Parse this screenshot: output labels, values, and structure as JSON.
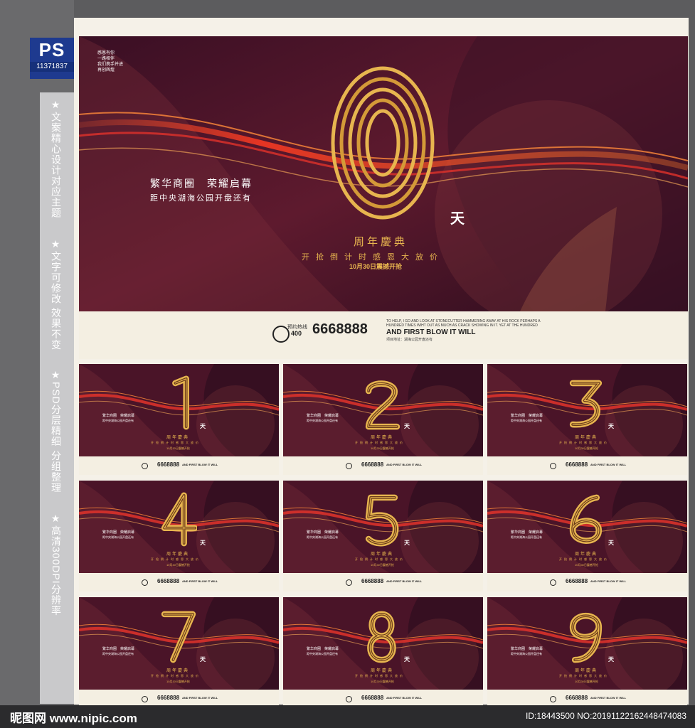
{
  "badge": {
    "label": "PS",
    "number": "11371837"
  },
  "features": [
    "★文案精心设计对应主题",
    "★文字可修改 效果不变",
    "★PSD分层精细 分组整理",
    "★高清300DPI分辨率"
  ],
  "main_poster": {
    "digit": "0",
    "small_text": [
      "感恩有你",
      "一路相伴",
      "我们携手并进",
      "再创辉煌"
    ],
    "headline": "繁华商圈　荣耀启幕",
    "subline": "距中央湖海公园开盘还有",
    "unit": "天",
    "anniversary": "周年慶典",
    "promo": "开抢倒计时感恩大放价",
    "date_line": "10月30日震撼开抢",
    "hotline_label": "预约热线",
    "hotline_prefix": "400",
    "hotline_number": "6668888",
    "english_small": "TO HELP, I GO AND LOOK AT STONECUTTER HAMMERING AWAY AT HIS ROCK PERHAPS A HUNDRED TIMES WIHT OUT AS MUCH AS CRACK SHOWING IN IT. YET AT THE HUNDRED",
    "english_big": "AND FIRST BLOW IT WILL",
    "chinese_small": "项目地址：湖海公园开盘还有"
  },
  "small_posters": [
    {
      "digit": "1"
    },
    {
      "digit": "2"
    },
    {
      "digit": "3"
    },
    {
      "digit": "4"
    },
    {
      "digit": "5"
    },
    {
      "digit": "6"
    },
    {
      "digit": "7"
    },
    {
      "digit": "8"
    },
    {
      "digit": "9"
    }
  ],
  "small_text": {
    "headline": "繁华商圈　荣耀启幕",
    "subline": "距中央湖海公园开盘还有",
    "unit": "天",
    "anniversary": "周年慶典",
    "promo": "开抢倒计时感恩大放价",
    "date_line": "10月30日震撼开抢",
    "hotline_number": "6668888",
    "english_big": "AND FIRST BLOW IT WILL"
  },
  "footer_bar": {
    "site": "昵图网 www.nipic.com",
    "id_text": "ID:18443500 NO:20191122162448474083"
  },
  "colors": {
    "gold": "#e7b54f",
    "bg_dark": "#2a0c1d",
    "bg_red": "#6a1a2c",
    "ribbon": "#e0322a",
    "cream": "#f4efe2"
  }
}
